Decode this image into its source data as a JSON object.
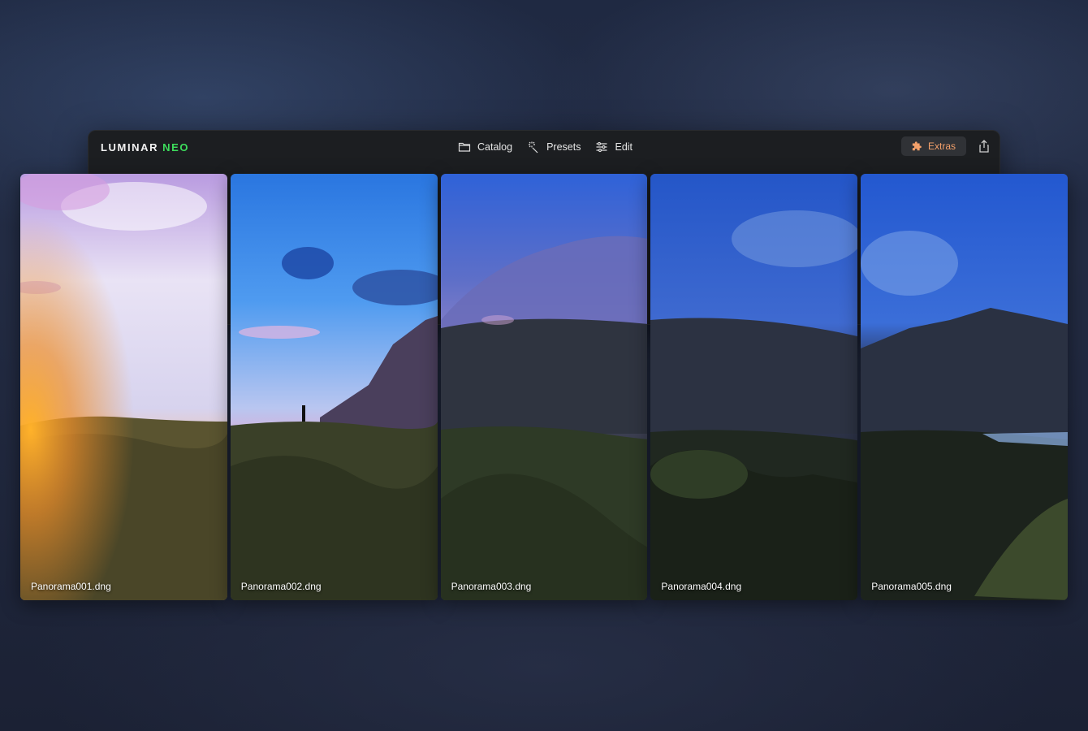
{
  "app": {
    "logo_main": "LUMINAR",
    "logo_accent": "NEO",
    "accent_color": "#3ddc5c"
  },
  "nav": {
    "items": [
      {
        "label": "Catalog",
        "icon": "folder-icon"
      },
      {
        "label": "Presets",
        "icon": "magic-wand-icon"
      },
      {
        "label": "Edit",
        "icon": "sliders-icon"
      }
    ]
  },
  "toolbar": {
    "extras_label": "Extras",
    "extras_icon": "puzzle-icon",
    "extras_color": "#f3a06a",
    "share_icon": "share-icon"
  },
  "panels": [
    {
      "filename": "Panorama001.dng"
    },
    {
      "filename": "Panorama002.dng"
    },
    {
      "filename": "Panorama003.dng"
    },
    {
      "filename": "Panorama004.dng"
    },
    {
      "filename": "Panorama005.dng"
    }
  ]
}
